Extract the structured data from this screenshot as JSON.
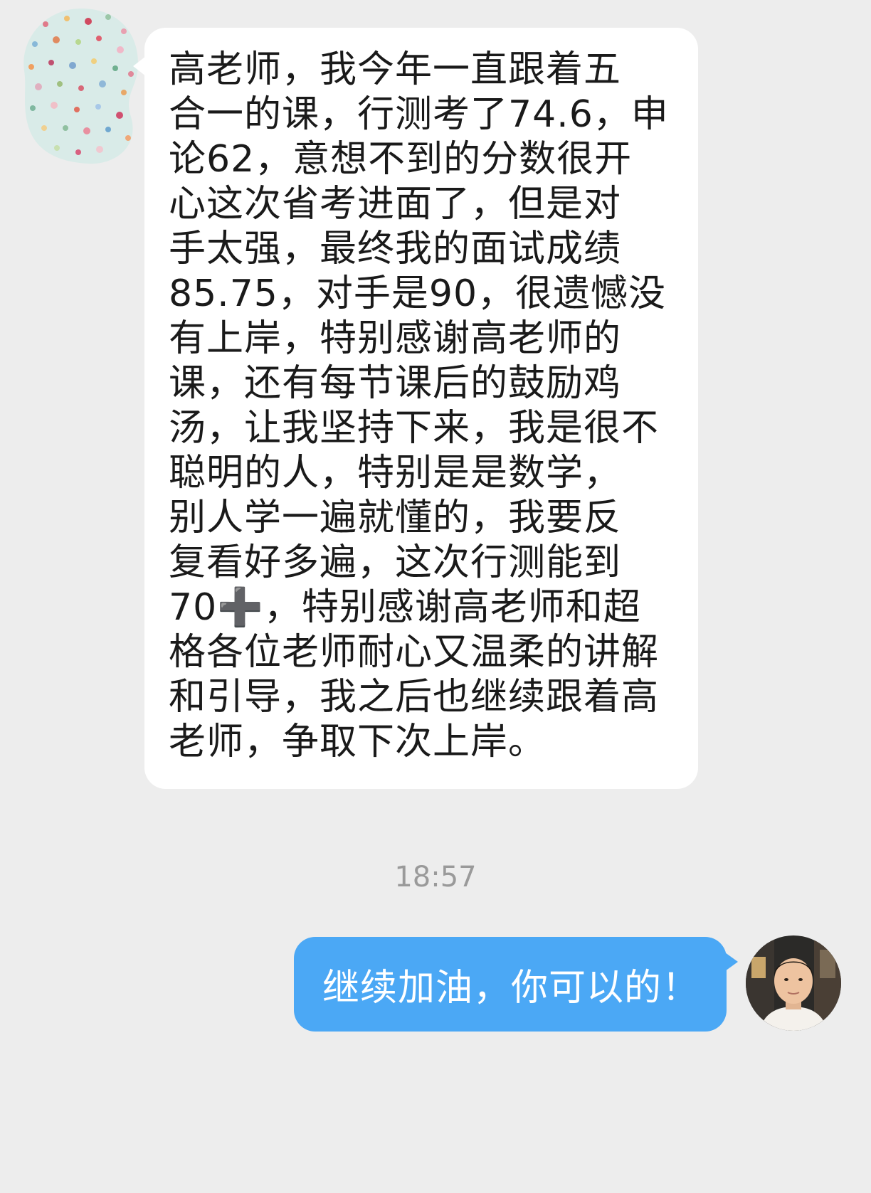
{
  "conversation": {
    "incoming": {
      "lines": [
        "高老师，我今年一直跟着五",
        "合一的课，行测考了74.6，申",
        "论62，意想不到的分数很开",
        "心这次省考进面了，但是对",
        "手太强，最终我的面试成绩",
        "85.75，对手是90，很遗憾没",
        "有上岸，特别感谢高老师的",
        "课，还有每节课后的鼓励鸡",
        "汤，让我坚持下来，我是很不",
        "聪明的人，特别是是数学，",
        "别人学一遍就懂的，我要反",
        "复看好多遍，这次行测能到",
        "70➕，特别感谢高老师和超",
        "格各位老师耐心又温柔的讲解",
        "和引导，我之后也继续跟着高",
        "老师，争取下次上岸。"
      ]
    },
    "timestamp": "18:57",
    "outgoing": {
      "text": "继续加油，你可以的！"
    }
  },
  "colors": {
    "background": "#ededed",
    "incoming_bubble": "#ffffff",
    "outgoing_bubble": "#4ba8f5",
    "timestamp_text": "#9a9a9a"
  },
  "icons": {
    "incoming_avatar": "polka-dot-avatar",
    "outgoing_avatar": "user-photo-avatar"
  }
}
